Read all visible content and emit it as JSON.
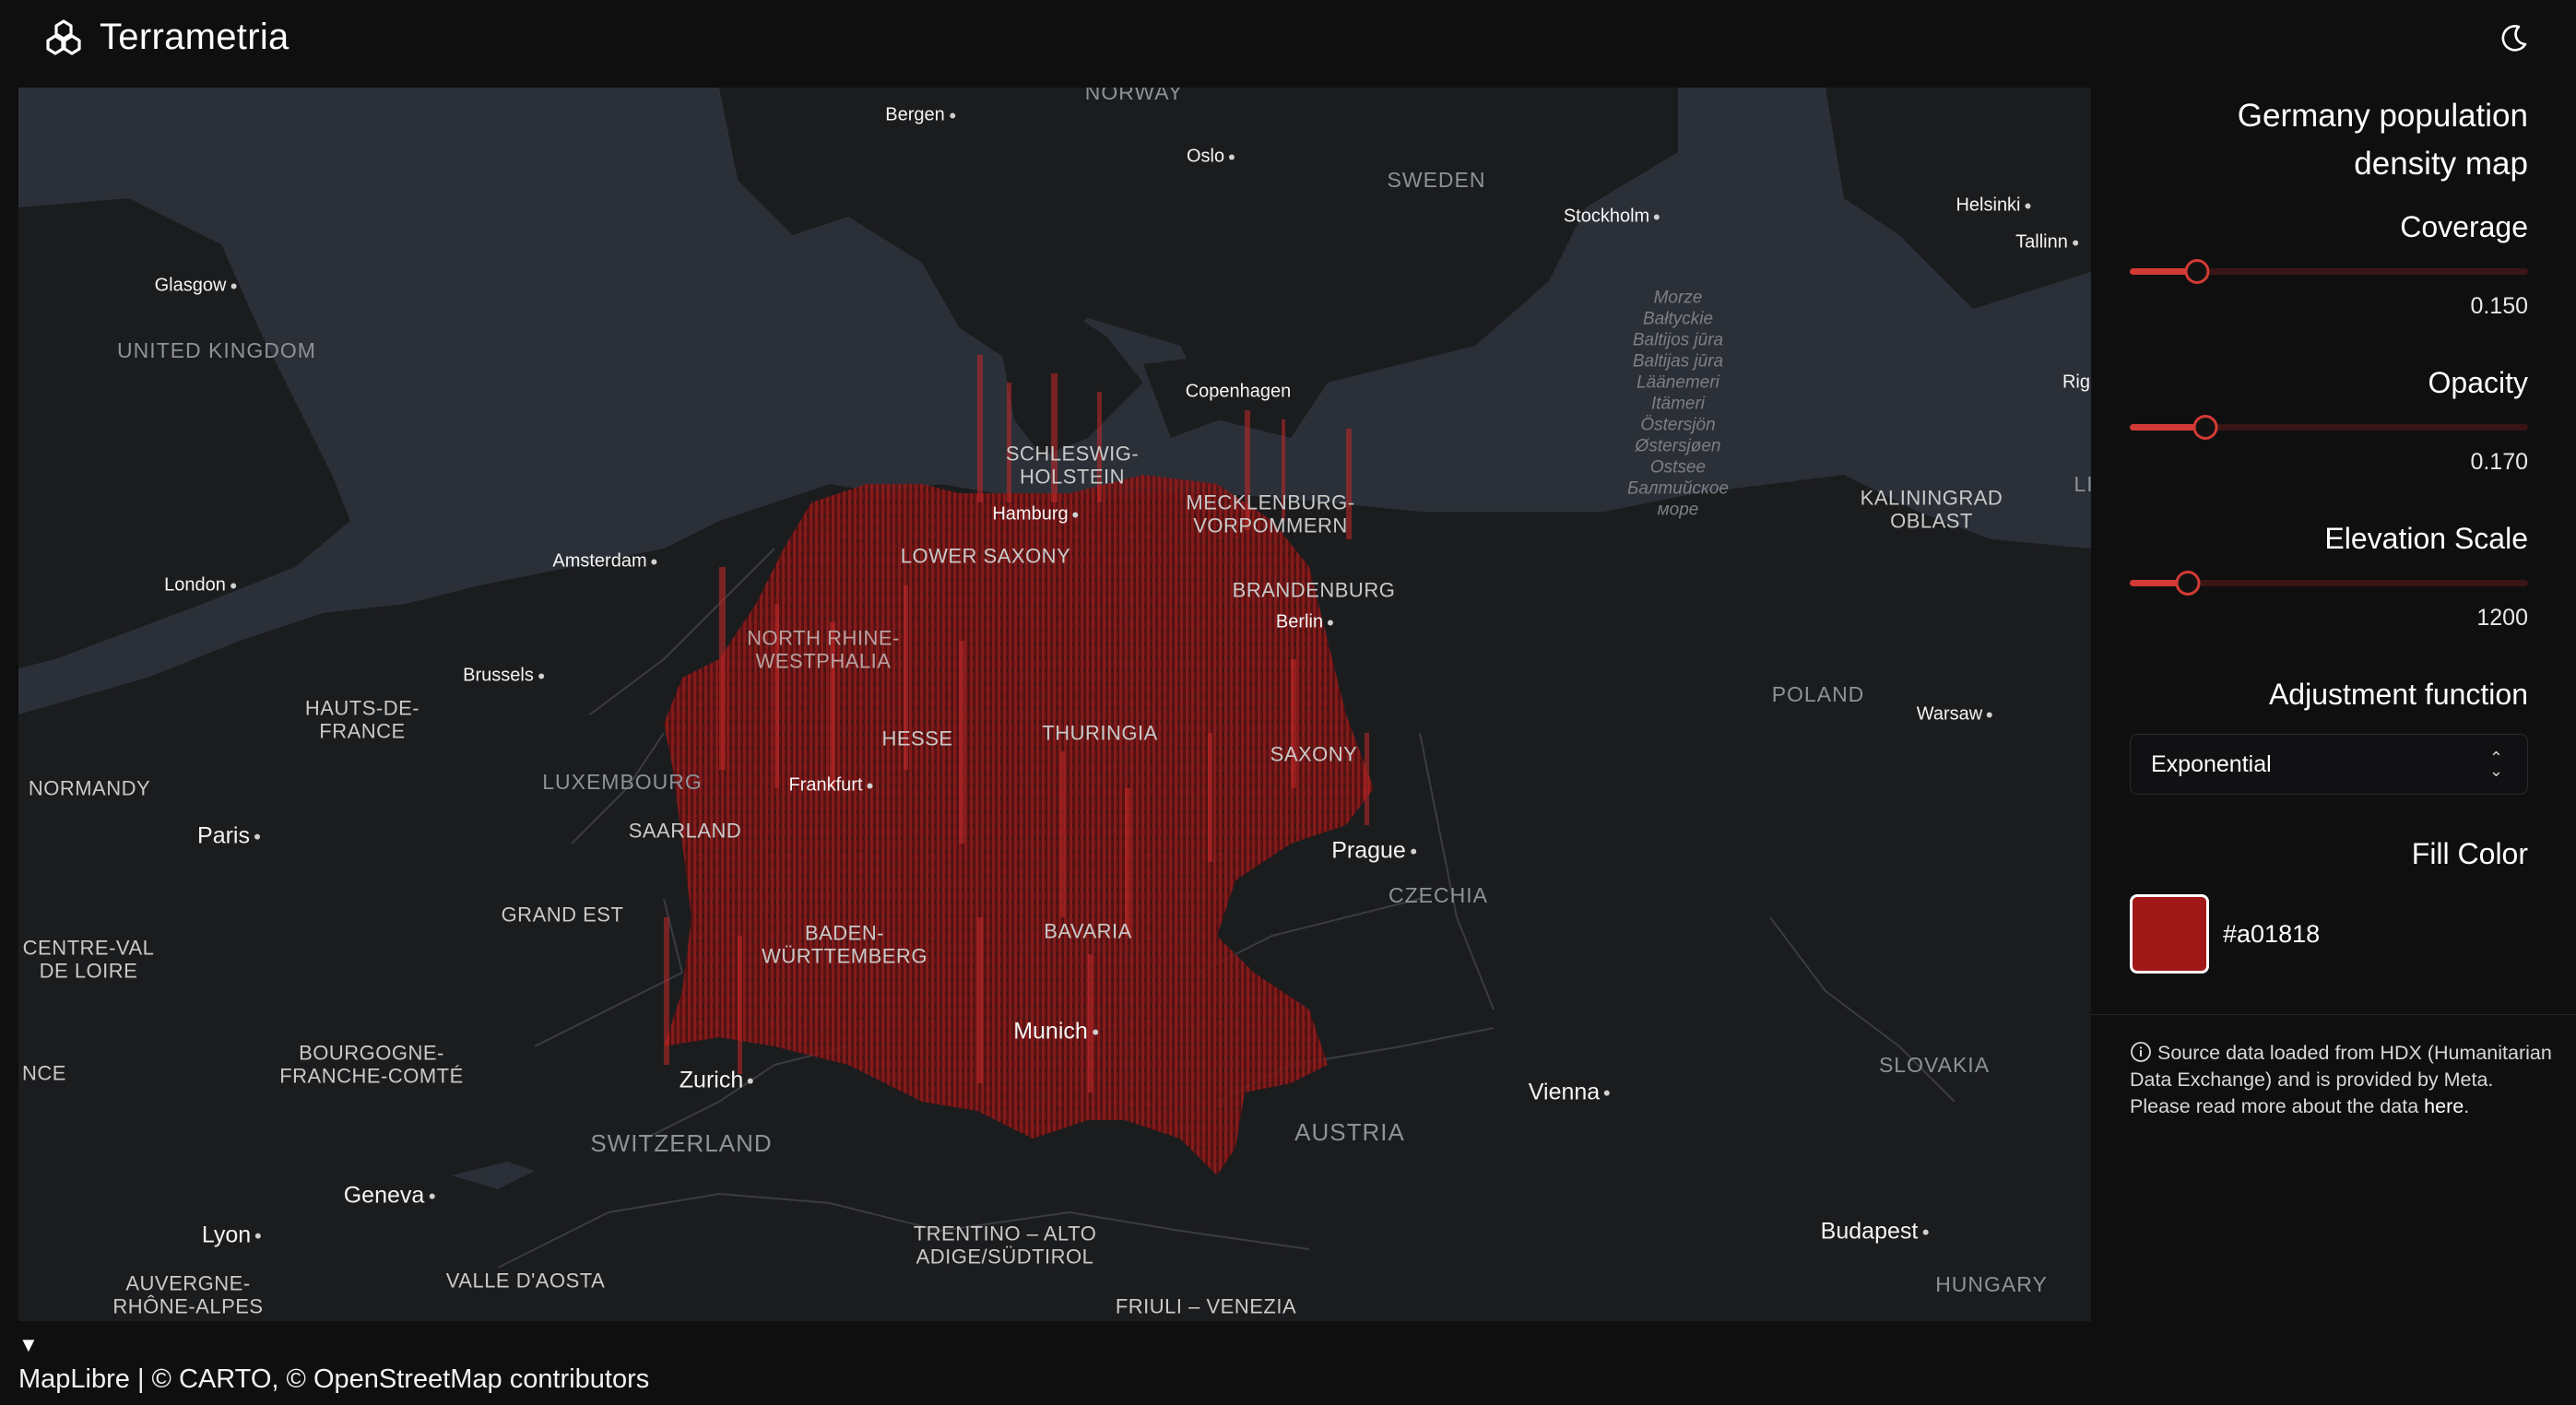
{
  "header": {
    "app_name": "Terrametria",
    "logo_icon": "terrametria-logo-icon",
    "theme_toggle_icon": "moon-icon"
  },
  "map": {
    "labels": {
      "norway": "NORWAY",
      "bergen": "Bergen",
      "oslo": "Oslo",
      "sweden": "SWEDEN",
      "stockholm": "Stockholm",
      "helsinki": "Helsinki",
      "tallinn": "Tallinn",
      "riga": "Rig",
      "glasgow": "Glasgow",
      "united_kingdom": "UNITED KINGDOM",
      "copenhagen": "Copenhagen",
      "baltic_sea": "Morze\nBałtyckie\nBaltijos jūra\nBaltijas jūra\nLäänemeri\nItämeri\nÖstersjön\nØstersjøen\nOstsee\nБалтийское\nморе",
      "schleswig_holstein": "SCHLESWIG-\nHOLSTEIN",
      "hamburg": "Hamburg",
      "mecklenburg": "MECKLENBURG-\nVORPOMMERN",
      "kaliningrad": "KALININGRAD\nOBLAST",
      "li": "LI",
      "amsterdam": "Amsterdam",
      "lower_saxony": "LOWER SAXONY",
      "london": "London",
      "brandenburg": "BRANDENBURG",
      "berlin": "Berlin",
      "north_rhine": "NORTH RHINE-\nWESTPHALIA",
      "brussels": "Brussels",
      "hauts_de_france": "HAUTS-DE-\nFRANCE",
      "poland": "POLAND",
      "warsaw": "Warsaw",
      "hesse": "HESSE",
      "thuringia": "THURINGIA",
      "saxony": "SAXONY",
      "luxembourg": "LUXEMBOURG",
      "frankfurt": "Frankfurt",
      "normandy": "NORMANDY",
      "paris": "Paris",
      "saarland": "SAARLAND",
      "prague": "Prague",
      "czechia": "CZECHIA",
      "grand_est": "GRAND EST",
      "baden_wuerttemberg": "BADEN-\nWÜRTTEMBERG",
      "bavaria": "BAVARIA",
      "centre_val_de_loire": "CENTRE-VAL\nDE LOIRE",
      "munich": "Munich",
      "bourgogne": "BOURGOGNE-\nFRANCHE-COMTÉ",
      "nce": "NCE",
      "zurich": "Zurich",
      "slovakia": "SLOVAKIA",
      "vienna": "Vienna",
      "switzerland": "SWITZERLAND",
      "austria": "AUSTRIA",
      "geneva": "Geneva",
      "lyon": "Lyon",
      "trentino": "TRENTINO – ALTO\nADIGE/SÜDTIROL",
      "budapest": "Budapest",
      "auvergne": "AUVERGNE-\nRHÔNE-ALPES",
      "valle_daosta": "VALLE D'AOSTA",
      "friuli": "FRIULI – VENEZIA",
      "hungary": "HUNGARY"
    }
  },
  "attribution": "MapLibre | © CARTO, © OpenStreetMap contributors",
  "collapse_toggle": "▼",
  "panel": {
    "title": "Germany population density map",
    "coverage": {
      "label": "Coverage",
      "value": "0.150",
      "level": 0.17
    },
    "opacity": {
      "label": "Opacity",
      "value": "0.170",
      "level": 0.19
    },
    "elevation_scale": {
      "label": "Elevation Scale",
      "value": "1200",
      "level": 0.145
    },
    "adjustment_function": {
      "label": "Adjustment function",
      "selected": "Exponential"
    },
    "fill_color": {
      "label": "Fill Color",
      "hex": "#a01818",
      "swatch": "#a01818"
    },
    "note": {
      "icon": "info-icon",
      "text": "Source data loaded from HDX (Humanitarian Data Exchange) and is provided by Meta.",
      "read_more": "Please read more about the data",
      "link": "here",
      "end": "."
    }
  },
  "colors": {
    "water": "#2b3038",
    "land": "#1b1c1e",
    "density": "#a01818",
    "accent": "#d33a35"
  }
}
